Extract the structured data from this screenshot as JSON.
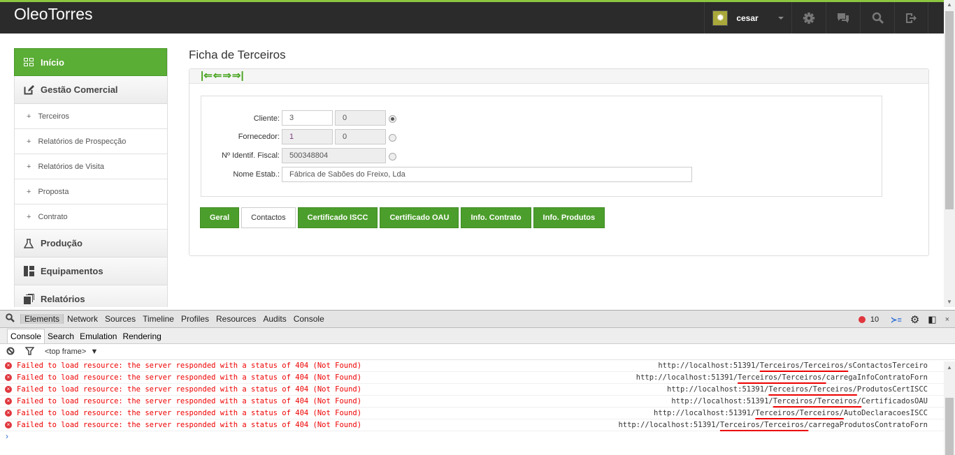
{
  "header": {
    "logo": "OleoTorres",
    "user": "cesar",
    "accent": "#8cc63f"
  },
  "sidebar": {
    "items": [
      {
        "label": "Início",
        "icon": "grid-icon",
        "active": true
      },
      {
        "label": "Gestão Comercial",
        "icon": "edit-icon"
      },
      {
        "label": "Terceiros",
        "sub": true
      },
      {
        "label": "Relatórios de Prospecção",
        "sub": true
      },
      {
        "label": "Relatórios de Visita",
        "sub": true
      },
      {
        "label": "Proposta",
        "sub": true
      },
      {
        "label": "Contrato",
        "sub": true
      },
      {
        "label": "Produção",
        "icon": "flask-icon"
      },
      {
        "label": "Equipamentos",
        "icon": "dashboard-icon"
      },
      {
        "label": "Relatórios",
        "icon": "copy-icon"
      }
    ]
  },
  "main": {
    "title": "Ficha de Terceiros",
    "form": {
      "cliente_label": "Cliente:",
      "cliente_value": "3",
      "cliente_value2": "0",
      "fornecedor_label": "Fornecedor:",
      "fornecedor_value": "1",
      "fornecedor_value2": "0",
      "nif_label": "Nº Identif. Fiscal:",
      "nif_value": "500348804",
      "nome_label": "Nome Estab.:",
      "nome_value": "Fábrica de Sabões do Freixo, Lda",
      "selected_radio": "cliente"
    },
    "tabs": [
      "Geral",
      "Contactos",
      "Certificado ISCC",
      "Certificado OAU",
      "Info. Contrato",
      "Info. Produtos"
    ],
    "selected_tab": "Contactos"
  },
  "devtools": {
    "tabs": [
      "Elements",
      "Network",
      "Sources",
      "Timeline",
      "Profiles",
      "Resources",
      "Audits",
      "Console"
    ],
    "error_count": "10",
    "drawer_tabs": [
      "Console",
      "Search",
      "Emulation",
      "Rendering"
    ],
    "frame": "<top frame>",
    "messages": [
      {
        "text": "Failed to load resource: the server responded with a status of 404 (Not Found)",
        "host": "http://localhost:51391/",
        "path": "Terceiros/Terceiros/",
        "file": "sContactosTerceiro"
      },
      {
        "text": "Failed to load resource: the server responded with a status of 404 (Not Found)",
        "host": "http://localhost:51391/",
        "path": "Terceiros/Terceiros/",
        "file": "carregaInfoContratoForn"
      },
      {
        "text": "Failed to load resource: the server responded with a status of 404 (Not Found)",
        "host": "http://localhost:51391/",
        "path": "Terceiros/Terceiros/",
        "file": "ProdutosCertISCC"
      },
      {
        "text": "Failed to load resource: the server responded with a status of 404 (Not Found)",
        "host": "http://localhost:51391/",
        "path": "Terceiros/Terceiros/",
        "file": "CertificadosOAU"
      },
      {
        "text": "Failed to load resource: the server responded with a status of 404 (Not Found)",
        "host": "http://localhost:51391/",
        "path": "Terceiros/Terceiros/",
        "file": "AutoDeclaracoesISCC"
      },
      {
        "text": "Failed to load resource: the server responded with a status of 404 (Not Found)",
        "host": "http://localhost:51391/",
        "path": "Terceiros/Terceiros/",
        "file": "carregaProdutosContratoForn"
      }
    ]
  }
}
